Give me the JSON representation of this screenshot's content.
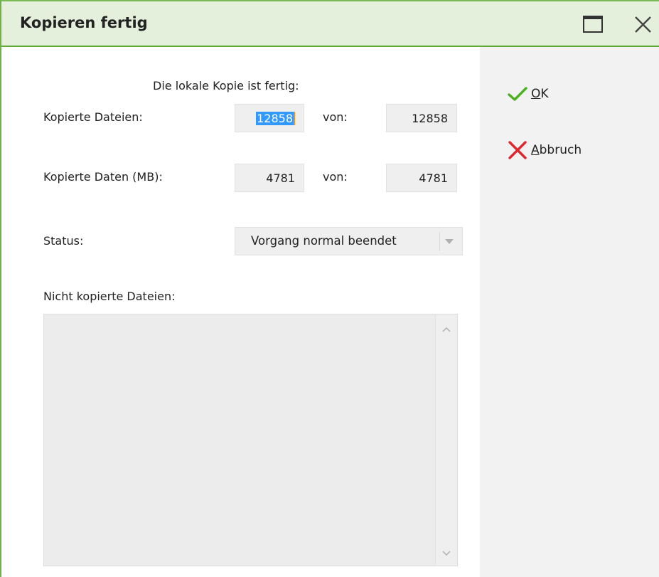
{
  "window": {
    "title": "Kopieren fertig",
    "accent_color": "#6fb04a",
    "titlebar_color": "#e5f0dc",
    "maximize_icon": "maximize-icon",
    "close_icon": "close-icon"
  },
  "form": {
    "heading": "Die lokale Kopie ist fertig:",
    "files_label": "Kopierte Dateien:",
    "files_value": "12858",
    "files_of_label": "von:",
    "files_total": "12858",
    "data_label": "Kopierte Daten (MB):",
    "data_value": "4781",
    "data_of_label": "von:",
    "data_total": "4781",
    "status_label": "Status:",
    "status_value": "Vorgang normal beendet",
    "not_copied_label": "Nicht kopierte Dateien:",
    "not_copied_items": []
  },
  "actions": {
    "ok_label": "OK",
    "ok_icon": "checkmark-icon",
    "ok_color": "#4caf1e",
    "cancel_label": "Abbruch",
    "cancel_icon": "x-icon",
    "cancel_color": "#e0262a"
  }
}
